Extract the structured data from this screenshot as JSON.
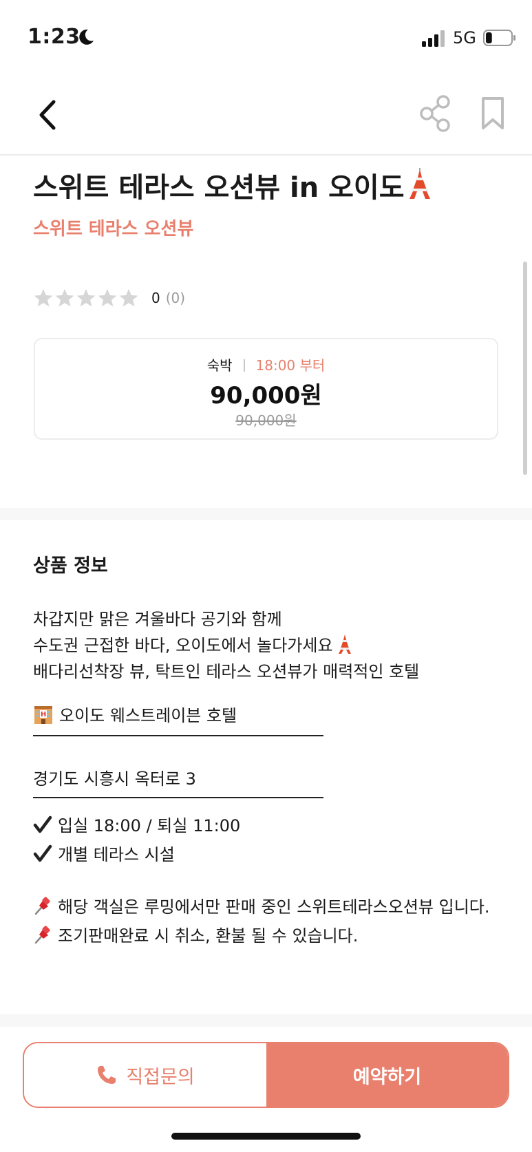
{
  "status_bar": {
    "time": "1:23",
    "network": "5G",
    "battery_level": 0.25
  },
  "title": "스위트 테라스 오션뷰 in 오이도",
  "subtitle": "스위트 테라스 오션뷰",
  "rating": {
    "score": "0",
    "count": "(0)",
    "stars_filled": 0,
    "stars_total": 5
  },
  "price_card": {
    "type": "숙박",
    "time": "18:00 부터",
    "price": "90,000원",
    "original_price": "90,000원"
  },
  "product_info": {
    "section_title": "상품 정보",
    "desc_line1": "차갑지만 맑은 겨울바다 공기와 함께",
    "desc_line2": "수도권 근접한 바다, 오이도에서 놀다가세요",
    "desc_line3": "배다리선착장 뷰, 탁트인 테라스 오션뷰가 매력적인 호텔",
    "hotel_name": "오이도 웨스트레이븐 호텔",
    "address": "경기도 시흥시 옥터로 3",
    "check_times": "입실 18:00 / 퇴실 11:00",
    "facility": "개별 테라스 시설",
    "notice1": "해당 객실은 루밍에서만 판매 중인 스위트테라스오션뷰 입니다.",
    "notice2": "조기판매완료 시 취소, 환불 될 수 있습니다."
  },
  "bottom_bar": {
    "contact_label": "직접문의",
    "reserve_label": "예약하기"
  },
  "colors": {
    "accent": "#e8806d",
    "star_empty": "#d6d6d6",
    "text_primary": "#1a1a1a",
    "text_muted": "#9a9a9a"
  },
  "icons": {
    "back": "chevron-left-icon",
    "share": "share-icon",
    "bookmark": "bookmark-icon",
    "tower": "tokyo-tower-emoji",
    "hotel": "hotel-emoji",
    "check": "check-mark-icon",
    "pin": "pushpin-emoji",
    "phone": "phone-icon"
  }
}
